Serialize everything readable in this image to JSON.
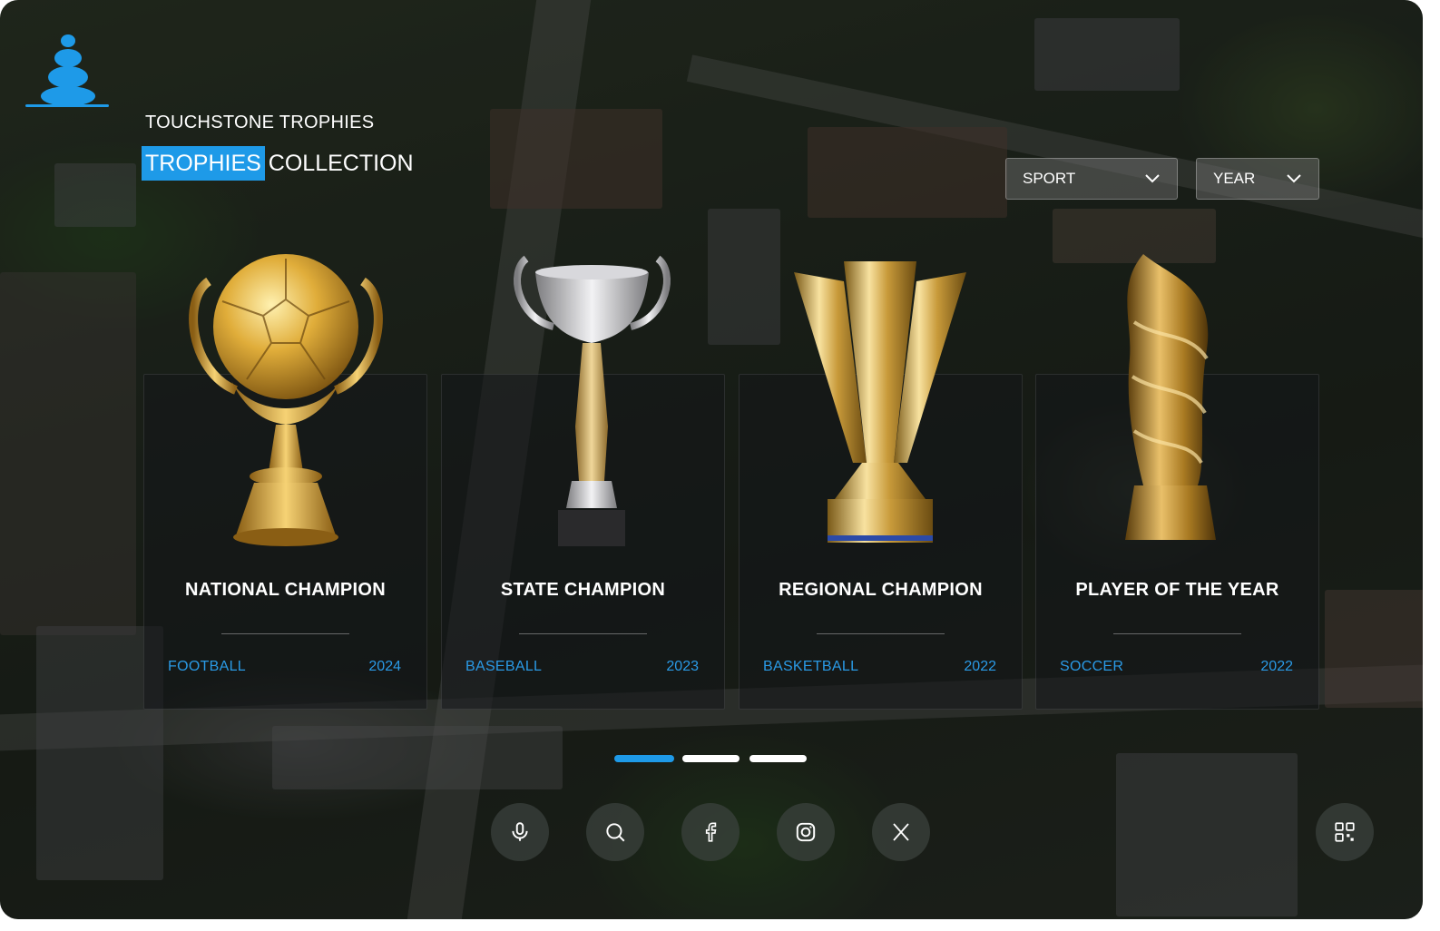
{
  "brand": {
    "name": "TOUCHSTONE TROPHIES"
  },
  "headline": {
    "accent": "TROPHIES",
    "rest": "COLLECTION"
  },
  "filters": {
    "sport_label": "SPORT",
    "year_label": "YEAR"
  },
  "cards": [
    {
      "title": "NATIONAL CHAMPION",
      "sport": "FOOTBALL",
      "year": "2024",
      "trophy": "gold-soccer-ball-cup"
    },
    {
      "title": "STATE CHAMPION",
      "sport": "BASEBALL",
      "year": "2023",
      "trophy": "silver-cup"
    },
    {
      "title": "REGIONAL CHAMPION",
      "sport": "BASKETBALL",
      "year": "2022",
      "trophy": "gold-tall-cup"
    },
    {
      "title": "PLAYER OF THE YEAR",
      "sport": "SOCCER",
      "year": "2022",
      "trophy": "gold-twisted-award"
    }
  ],
  "pagination": {
    "pages": 3,
    "active": 1
  },
  "actions": [
    "microphone-icon",
    "search-icon",
    "facebook-icon",
    "instagram-icon",
    "x-icon",
    "qr-code-icon"
  ],
  "colors": {
    "accent": "#1e9ae8",
    "link": "#2a9ae6"
  }
}
